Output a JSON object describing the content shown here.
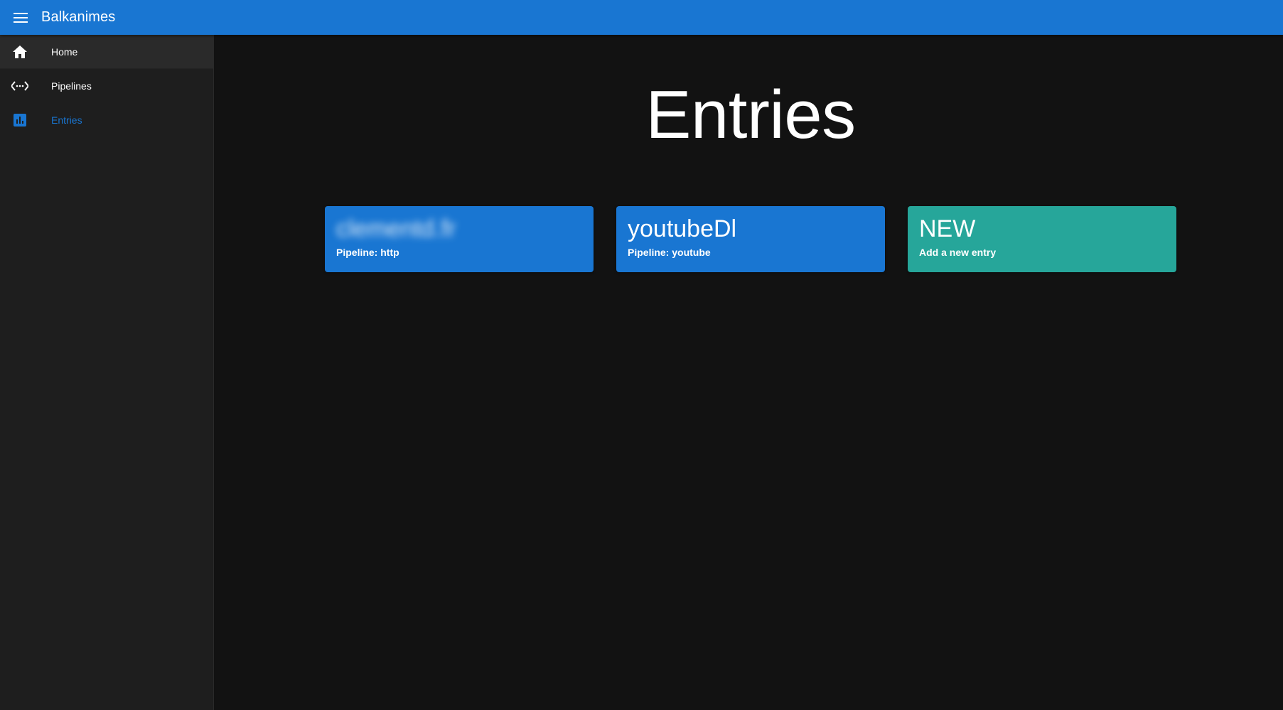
{
  "app_bar": {
    "title": "Balkanimes",
    "menu_icon": "menu-icon",
    "color": "#1976d2"
  },
  "sidebar": {
    "items": [
      {
        "label": "Home",
        "icon": "home-icon",
        "selected": false
      },
      {
        "label": "Pipelines",
        "icon": "code-arrows-icon",
        "selected": false
      },
      {
        "label": "Entries",
        "icon": "bar-chart-icon",
        "selected": true
      }
    ]
  },
  "main": {
    "title": "Entries",
    "cards": [
      {
        "title": "clementd.fr",
        "subtitle": "Pipeline: http",
        "color": "#1976d2"
      },
      {
        "title": "youtubeDl",
        "subtitle": "Pipeline: youtube",
        "color": "#1976d2"
      },
      {
        "title": "NEW",
        "subtitle": "Add a new entry",
        "color": "#26a69a"
      }
    ]
  }
}
